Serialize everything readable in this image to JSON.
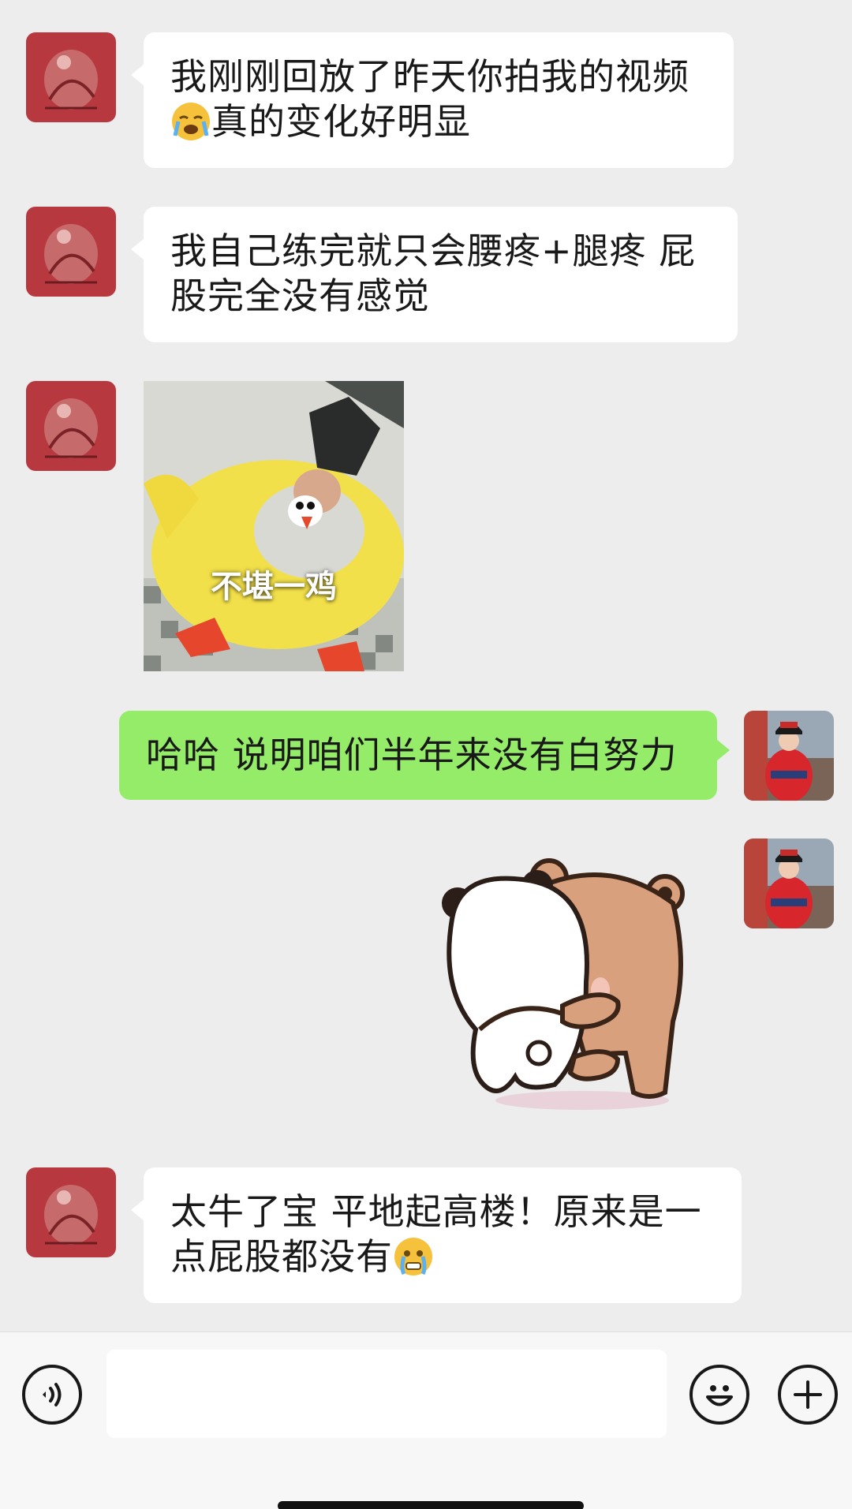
{
  "messages": [
    {
      "side": "left",
      "kind": "text",
      "line1": "我刚刚回放了昨天你拍我的视频",
      "line2_emoji": "crying-face",
      "line2": "真的变化好明显"
    },
    {
      "side": "left",
      "kind": "text",
      "line1": "我自己练完就只会腰疼+腿疼 屁",
      "line2": "股完全没有感觉"
    },
    {
      "side": "left",
      "kind": "image",
      "caption": "不堪一鸡"
    },
    {
      "side": "right",
      "kind": "text",
      "line1": "哈哈 说明咱们半年来没有白努力"
    },
    {
      "side": "right",
      "kind": "sticker",
      "sticker": "two-bears-hugging"
    },
    {
      "side": "left",
      "kind": "text",
      "line1": "太牛了宝 平地起高楼！原来是一",
      "line2": "点屁股都没有",
      "line2_emoji_after": "teary-face"
    }
  ],
  "input_bar": {
    "voice_icon": "voice-icon",
    "emoji_icon": "emoji-icon",
    "plus_icon": "plus-icon",
    "text_value": ""
  },
  "colors": {
    "background": "#ededed",
    "bubble_left": "#ffffff",
    "bubble_right": "#95ec69"
  }
}
